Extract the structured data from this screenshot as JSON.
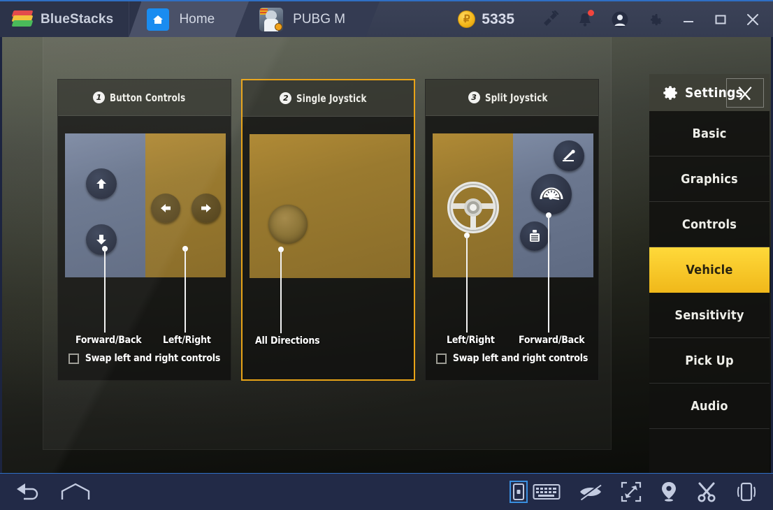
{
  "titlebar": {
    "brand": "BlueStacks",
    "brand_logo_icon": "bluestacks-logo-icon",
    "tabs": [
      {
        "label": "Home",
        "icon": "home-icon"
      },
      {
        "label": "PUBG M",
        "icon": "pubg-app-icon"
      }
    ],
    "coin_icon": "coin-icon",
    "coin_symbol": "₽",
    "coin_count": "5335",
    "icons": [
      {
        "name": "plug-icon"
      },
      {
        "name": "bell-icon",
        "has_badge": true
      },
      {
        "name": "account-icon"
      },
      {
        "name": "gear-icon"
      }
    ],
    "window_buttons": [
      {
        "name": "minimize-button",
        "glyph": "—"
      },
      {
        "name": "maximize-button",
        "glyph": "□"
      },
      {
        "name": "close-button",
        "glyph": "✕"
      }
    ]
  },
  "panels": [
    {
      "number": "1",
      "title": "Button Controls",
      "selected": false,
      "captions": [
        {
          "text": "Forward/Back"
        },
        {
          "text": "Left/Right"
        }
      ],
      "swap_label": "Swap left and right controls",
      "swap_checked": false,
      "icons": [
        "arrow-up-button-icon",
        "arrow-down-button-icon",
        "arrow-left-button-icon",
        "arrow-right-button-icon"
      ]
    },
    {
      "number": "2",
      "title": "Single Joystick",
      "selected": true,
      "captions": [
        {
          "text": "All Directions"
        }
      ],
      "swap_label": null,
      "swap_checked": null,
      "icons": [
        "joystick-pad-icon"
      ]
    },
    {
      "number": "3",
      "title": "Split Joystick",
      "selected": false,
      "captions": [
        {
          "text": "Left/Right"
        },
        {
          "text": "Forward/Back"
        }
      ],
      "swap_label": "Swap left and right controls",
      "swap_checked": false,
      "icons": [
        "steering-wheel-icon",
        "handbrake-icon",
        "speedometer-icon",
        "seat-icon"
      ]
    }
  ],
  "settings": {
    "title": "Settings",
    "gear_icon": "gear-icon",
    "close_icon": "close-icon",
    "nav": [
      {
        "label": "Basic",
        "active": false
      },
      {
        "label": "Graphics",
        "active": false
      },
      {
        "label": "Controls",
        "active": false
      },
      {
        "label": "Vehicle",
        "active": true
      },
      {
        "label": "Sensitivity",
        "active": false
      },
      {
        "label": "Pick Up",
        "active": false
      },
      {
        "label": "Audio",
        "active": false
      }
    ],
    "accent_color": "#f0b81a"
  },
  "bottombar": {
    "left_icons": [
      {
        "name": "back-icon"
      },
      {
        "name": "home-outline-icon"
      }
    ],
    "right_icons": [
      {
        "name": "gamepad-controls-icon"
      },
      {
        "name": "keyboard-icon"
      },
      {
        "name": "eye-slash-icon"
      },
      {
        "name": "fullscreen-icon"
      },
      {
        "name": "location-pin-icon"
      },
      {
        "name": "scissors-icon"
      },
      {
        "name": "shake-phone-icon"
      }
    ]
  }
}
